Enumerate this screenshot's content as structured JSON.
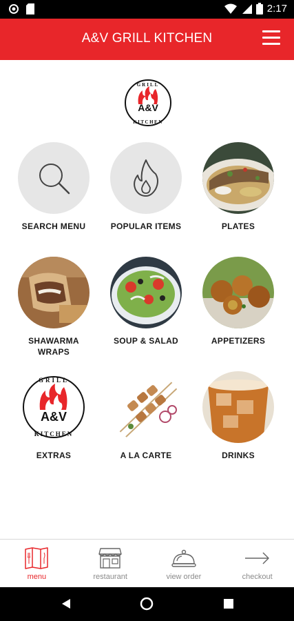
{
  "status": {
    "time": "2:17"
  },
  "header": {
    "title": "A&V GRILL KITCHEN"
  },
  "logo": {
    "top_text": "GRILL",
    "mark": "A&V",
    "bottom_text": "KITCHEN"
  },
  "tiles": [
    {
      "label": "SEARCH MENU",
      "icon": "search-icon"
    },
    {
      "label": "POPULAR ITEMS",
      "icon": "flame-icon"
    },
    {
      "label": "PLATES"
    },
    {
      "label": "SHAWARMA\nWRAPS"
    },
    {
      "label": "SOUP & SALAD"
    },
    {
      "label": "APPETIZERS"
    },
    {
      "label": "EXTRAS"
    },
    {
      "label": "A LA CARTE"
    },
    {
      "label": "DRINKS"
    }
  ],
  "bottom_nav": [
    {
      "label": "menu",
      "icon": "menu-book-icon",
      "active": true
    },
    {
      "label": "restaurant",
      "icon": "storefront-icon",
      "active": false
    },
    {
      "label": "view order",
      "icon": "cloche-icon",
      "active": false
    },
    {
      "label": "checkout",
      "icon": "arrow-right-icon",
      "active": false
    }
  ],
  "colors": {
    "brand_red": "#e8262a",
    "tile_grey": "#e6e6e6",
    "nav_inactive": "#8a8a8a"
  }
}
